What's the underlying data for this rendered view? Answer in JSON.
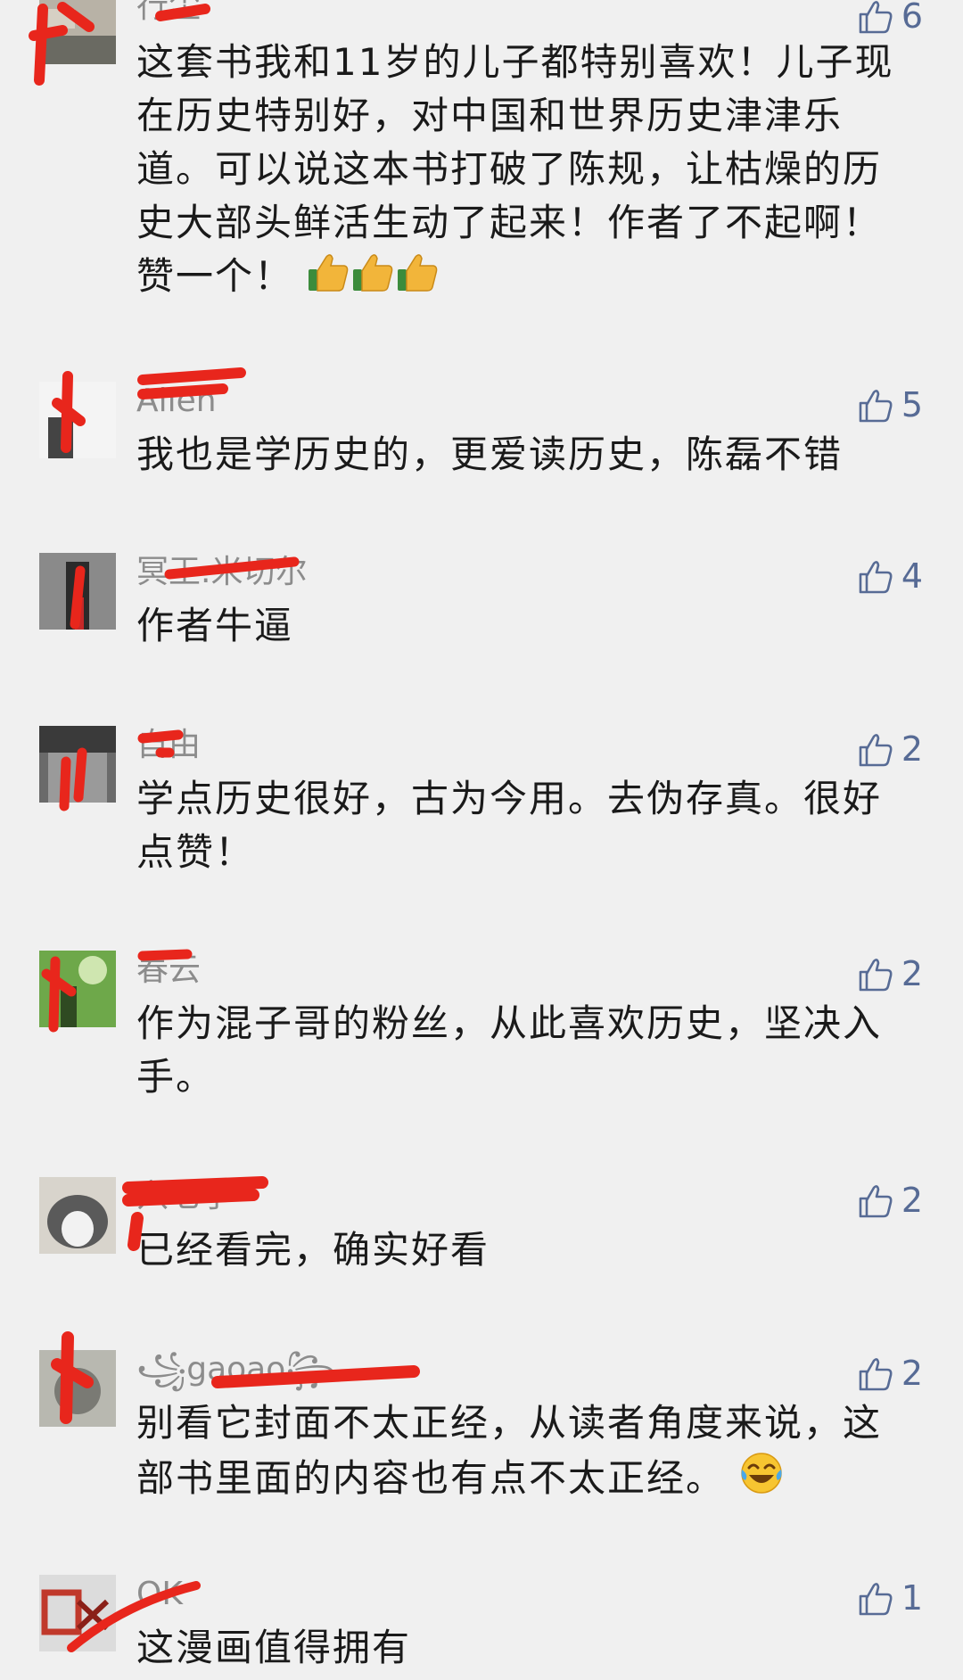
{
  "comments": [
    {
      "username": "行尘",
      "likes": "6",
      "content": "这套书我和11岁的儿子都特别喜欢！儿子现在历史特别好，对中国和世界历史津津乐道。可以说这本书打破了陈规，让枯燥的历史大部头鲜活生动了起来！作者了不起啊！赞一个！",
      "emoji": [
        "thumbs-up",
        "thumbs-up",
        "thumbs-up"
      ]
    },
    {
      "username": "Allen",
      "likes": "5",
      "content": "我也是学历史的，更爱读历史，陈磊不错"
    },
    {
      "username": "冥王.米切尔",
      "likes": "4",
      "content": "作者牛逼"
    },
    {
      "username": "自由",
      "likes": "2",
      "content": "学点历史很好，古为今用。去伪存真。很好点赞！"
    },
    {
      "username": "春云",
      "likes": "2",
      "content": "作为混子哥的粉丝，从此喜欢历史，坚决入手。"
    },
    {
      "username": "穴七子",
      "likes": "2",
      "content": "已经看完，确实好看"
    },
    {
      "username": "꧁gaoao꧂",
      "likes": "2",
      "content": "别看它封面不太正经，从读者角度来说，这部书里面的内容也有点不太正经。",
      "emoji": [
        "laughing-tears"
      ]
    },
    {
      "username": "OK",
      "likes": "1",
      "content": "这漫画值得拥有"
    }
  ],
  "colors": {
    "background": "#f0f0f0",
    "username": "#8c8c8c",
    "like_blue": "#576b95",
    "text": "#1a1a1a",
    "redaction": "#e8261c"
  }
}
